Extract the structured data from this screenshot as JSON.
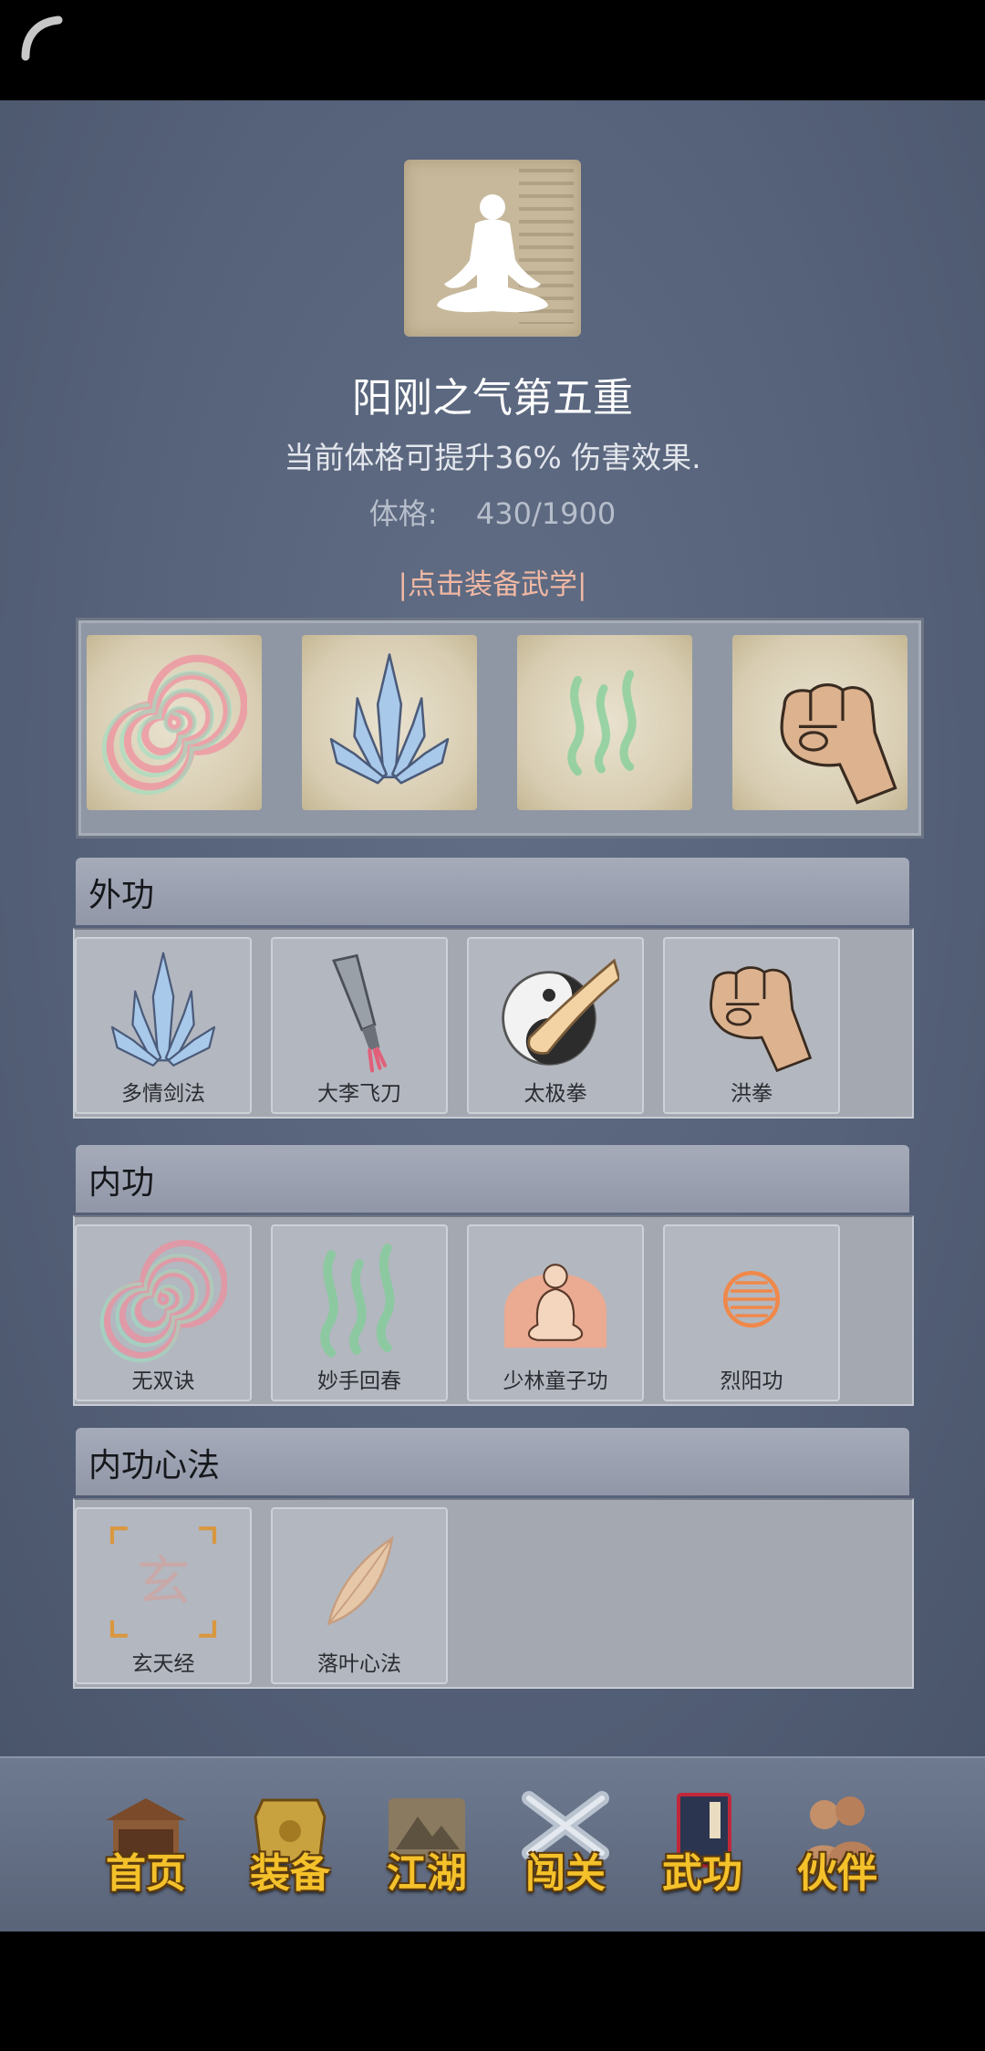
{
  "status": {
    "icon": "back-arc-icon"
  },
  "header": {
    "realm_title": "阳刚之气第五重",
    "description": "当前体格可提升36% 伤害效果.",
    "stat_label": "体格:",
    "stat_value": "430/1900",
    "equip_link": "|点击装备武学|"
  },
  "equipped": {
    "slots": [
      {
        "icon": "spiral-icon"
      },
      {
        "icon": "blade-fan-icon"
      },
      {
        "icon": "green-wave-icon"
      },
      {
        "icon": "fist-icon"
      }
    ]
  },
  "sections": {
    "external": {
      "title": "外功",
      "items": [
        {
          "label": "多情剑法",
          "icon": "blade-fan-icon"
        },
        {
          "label": "大李飞刀",
          "icon": "flying-knife-icon"
        },
        {
          "label": "太极拳",
          "icon": "taiji-fist-icon"
        },
        {
          "label": "洪拳",
          "icon": "fist-icon"
        }
      ]
    },
    "internal": {
      "title": "内功",
      "items": [
        {
          "label": "无双诀",
          "icon": "spiral-icon"
        },
        {
          "label": "妙手回春",
          "icon": "green-wave-icon"
        },
        {
          "label": "少林童子功",
          "icon": "meditating-monk-icon"
        },
        {
          "label": "烈阳功",
          "icon": "sun-orb-icon"
        }
      ]
    },
    "mind": {
      "title": "内功心法",
      "items": [
        {
          "label": "玄天经",
          "icon": "xuan-glyph-icon",
          "glyph": "玄"
        },
        {
          "label": "落叶心法",
          "icon": "leaf-icon"
        }
      ]
    }
  },
  "nav": {
    "items": [
      {
        "label": "首页",
        "icon": "temple-icon"
      },
      {
        "label": "装备",
        "icon": "armor-icon"
      },
      {
        "label": "江湖",
        "icon": "scroll-map-icon"
      },
      {
        "label": "闯关",
        "icon": "crossed-swords-icon"
      },
      {
        "label": "武功",
        "icon": "martial-book-icon",
        "selected": true
      },
      {
        "label": "伙伴",
        "icon": "companions-icon"
      }
    ]
  },
  "colors": {
    "background": "#56627a",
    "accent_link": "#f0b8a4",
    "nav_text": "#f4c12a"
  }
}
